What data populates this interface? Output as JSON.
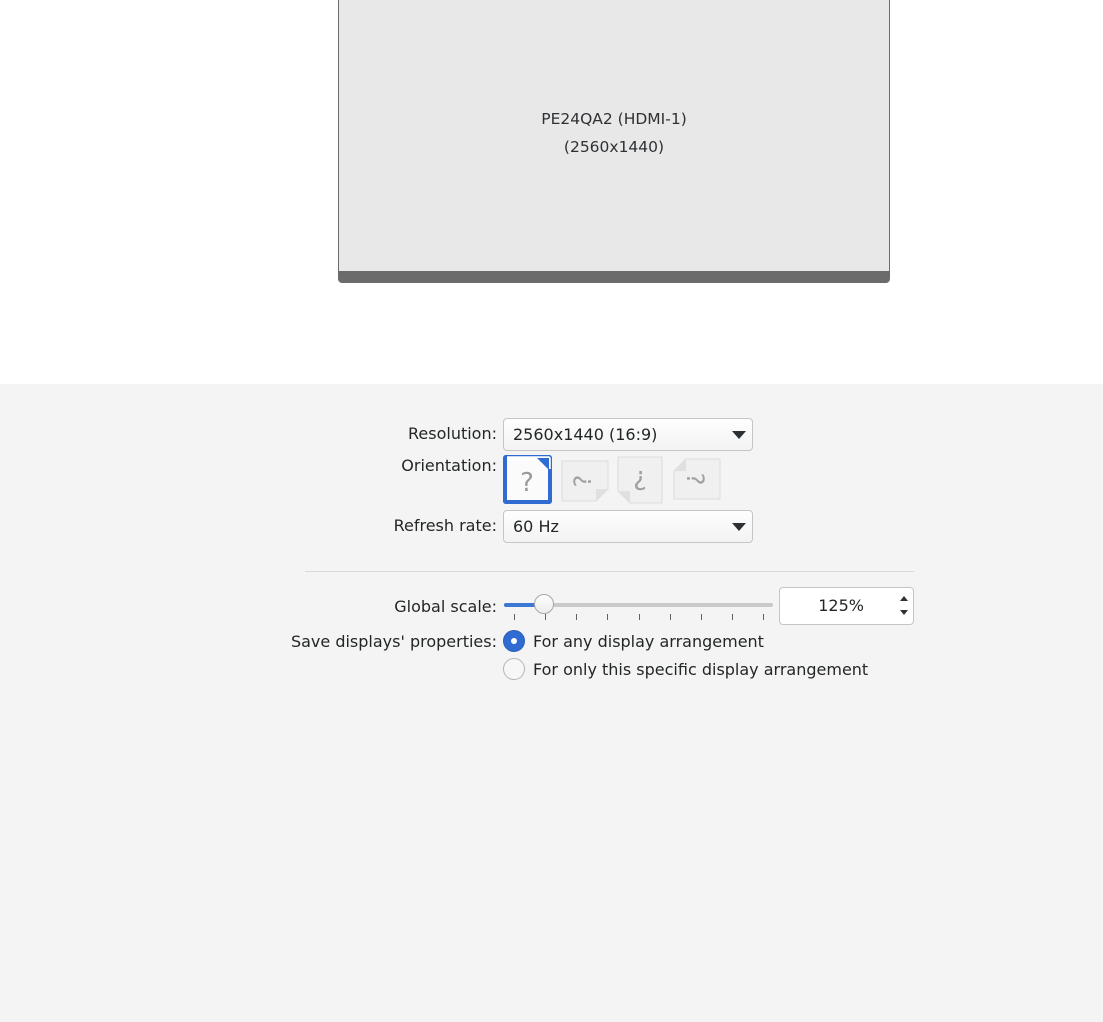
{
  "display": {
    "name": "PE24QA2 (HDMI-1)",
    "resolution_text": "(2560x1440)"
  },
  "settings": {
    "resolution": {
      "label": "Resolution:",
      "value": "2560x1440 (16:9)"
    },
    "orientation": {
      "label": "Orientation:",
      "options": [
        "no-rotation-icon",
        "rotate-left-icon",
        "upside-down-icon",
        "rotate-right-icon"
      ],
      "selected_index": 0
    },
    "refresh_rate": {
      "label": "Refresh rate:",
      "value": "60 Hz"
    },
    "global_scale": {
      "label": "Global scale:",
      "value": "125%",
      "slider_fraction": 0.125,
      "tick_count": 9
    },
    "save_properties": {
      "label": "Save displays' properties:",
      "options": [
        "For any display arrangement",
        "For only this specific display arrangement"
      ],
      "selected_index": 0
    }
  },
  "colors": {
    "accent": "#2f6bd1",
    "monitor_bg": "#e8e8e8",
    "monitor_border": "#6b6b6b",
    "panel_bg": "#f4f4f4"
  }
}
